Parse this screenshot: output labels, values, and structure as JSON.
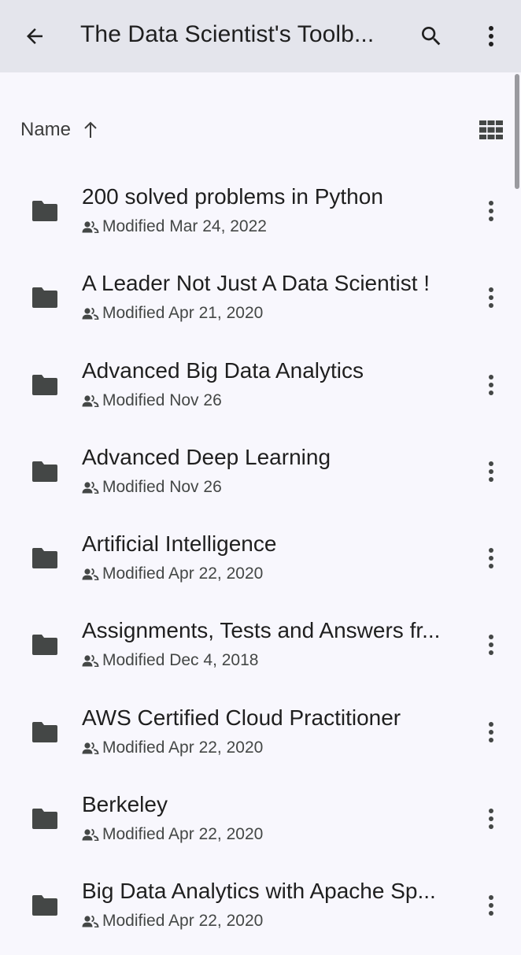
{
  "appbar": {
    "title": "The Data Scientist's Toolb...",
    "back_icon": "arrow-back-icon",
    "search_icon": "search-icon",
    "more_icon": "more-vert-icon"
  },
  "sort": {
    "label": "Name",
    "direction_icon": "arrow-up-icon",
    "view_toggle_icon": "grid-view-icon"
  },
  "items": [
    {
      "title": "200 solved problems in Python",
      "meta": "Modified Mar 24, 2022",
      "icon": "folder-icon",
      "shared_icon": "people-icon"
    },
    {
      "title": "A Leader Not Just A Data Scientist !",
      "meta": "Modified Apr 21, 2020",
      "icon": "folder-icon",
      "shared_icon": "people-icon"
    },
    {
      "title": "Advanced Big Data Analytics",
      "meta": "Modified Nov 26",
      "icon": "folder-icon",
      "shared_icon": "people-icon"
    },
    {
      "title": "Advanced Deep Learning",
      "meta": "Modified Nov 26",
      "icon": "folder-icon",
      "shared_icon": "people-icon"
    },
    {
      "title": "Artificial Intelligence",
      "meta": "Modified Apr 22, 2020",
      "icon": "folder-icon",
      "shared_icon": "people-icon"
    },
    {
      "title": "Assignments, Tests and Answers fr...",
      "meta": "Modified Dec 4, 2018",
      "icon": "folder-icon",
      "shared_icon": "people-icon"
    },
    {
      "title": "AWS  Certified Cloud Practitioner",
      "meta": "Modified Apr 22, 2020",
      "icon": "folder-icon",
      "shared_icon": "people-icon"
    },
    {
      "title": "Berkeley",
      "meta": "Modified Apr 22, 2020",
      "icon": "folder-icon",
      "shared_icon": "people-icon"
    },
    {
      "title": "Big Data Analytics with Apache Sp...",
      "meta": "Modified Apr 22, 2020",
      "icon": "folder-icon",
      "shared_icon": "people-icon"
    }
  ],
  "colors": {
    "appbar_bg": "#e4e5ec",
    "page_bg": "#f8f7fd",
    "icon": "#444746"
  }
}
